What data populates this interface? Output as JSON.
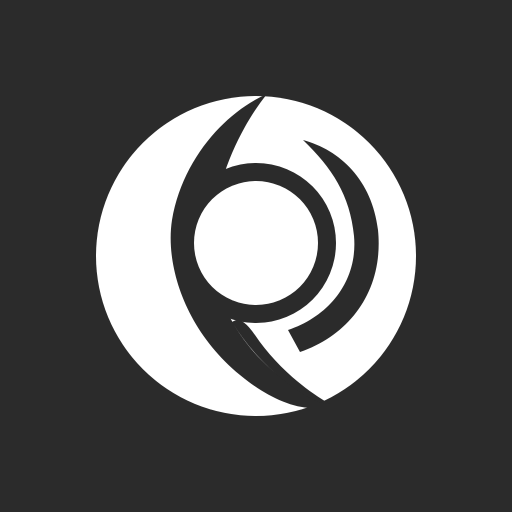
{
  "app": {
    "icon": "swirl-circle-logo-icon",
    "colors": {
      "background": "#2b2b2b",
      "foreground": "#ffffff"
    }
  }
}
